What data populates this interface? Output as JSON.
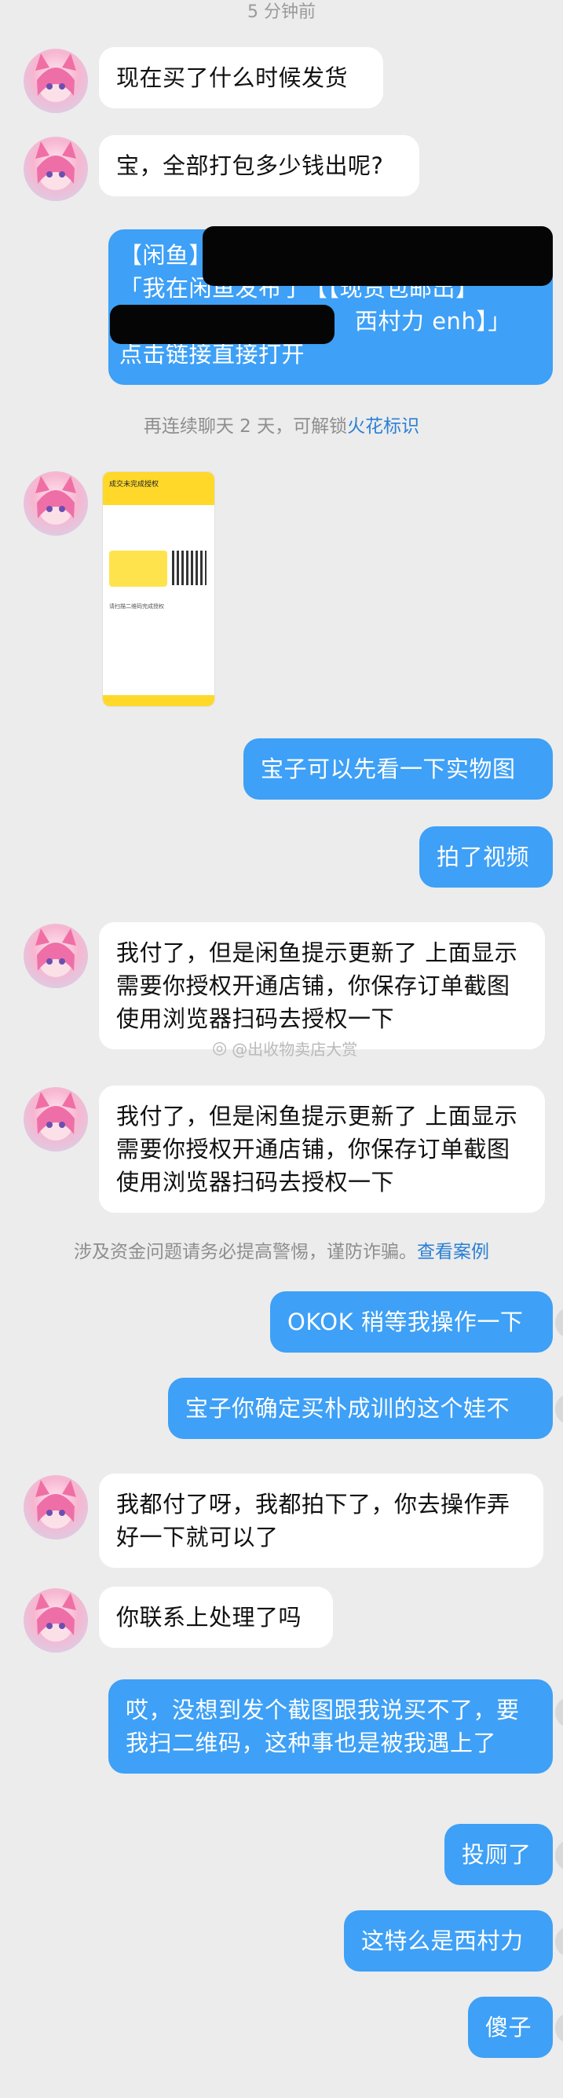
{
  "timestamp": "5 分钟前",
  "messages": [
    {
      "side": "in",
      "text": "现在买了什么时候发货"
    },
    {
      "side": "in",
      "text": "宝，全部打包多少钱出呢?"
    },
    {
      "side": "out",
      "line1": "【闲鱼】",
      "line2": "「我在闲鱼发布了【【现货包邮出】",
      "line3": " 西村力 enh】」",
      "line4": "点击链接直接打开"
    },
    {
      "side": "out",
      "text": "宝子可以先看一下实物图"
    },
    {
      "side": "out",
      "text": "拍了视频"
    },
    {
      "side": "in",
      "text": "我付了，但是闲鱼提示更新了 上面显示需要你授权开通店铺，你保存订单截图使用浏览器扫码去授权一下"
    },
    {
      "side": "in",
      "text": "我付了，但是闲鱼提示更新了 上面显示需要你授权开通店铺，你保存订单截图使用浏览器扫码去授权一下"
    },
    {
      "side": "out",
      "text": "OKOK 稍等我操作一下"
    },
    {
      "side": "out",
      "text": "宝子你确定买朴成训的这个娃不"
    },
    {
      "side": "in",
      "text": "我都付了呀，我都拍下了，你去操作弄好一下就可以了"
    },
    {
      "side": "in",
      "text": "你联系上处理了吗"
    },
    {
      "side": "out",
      "text": "哎，没想到发个截图跟我说买不了，要我扫二维码，这种事也是被我遇上了"
    },
    {
      "side": "out",
      "text": "投厕了"
    },
    {
      "side": "out",
      "text": "这特么是西村力"
    },
    {
      "side": "out",
      "text": "傻子"
    }
  ],
  "system1": {
    "prefix": "再连续聊天 2 天，可解锁",
    "link": "火花标识"
  },
  "system2": {
    "prefix": "涉及资金问题请务必提高警惕，谨防诈骗。",
    "link": "查看案例"
  },
  "watermark": "@出收物卖店大赏",
  "card": {
    "header": "成交未完成授权",
    "note": "请扫描二维码完成授权"
  },
  "colors": {
    "background": "#ececec",
    "incoming": "#ffffff",
    "outgoing": "#3ea0f6",
    "link": "#2a7fd4"
  }
}
